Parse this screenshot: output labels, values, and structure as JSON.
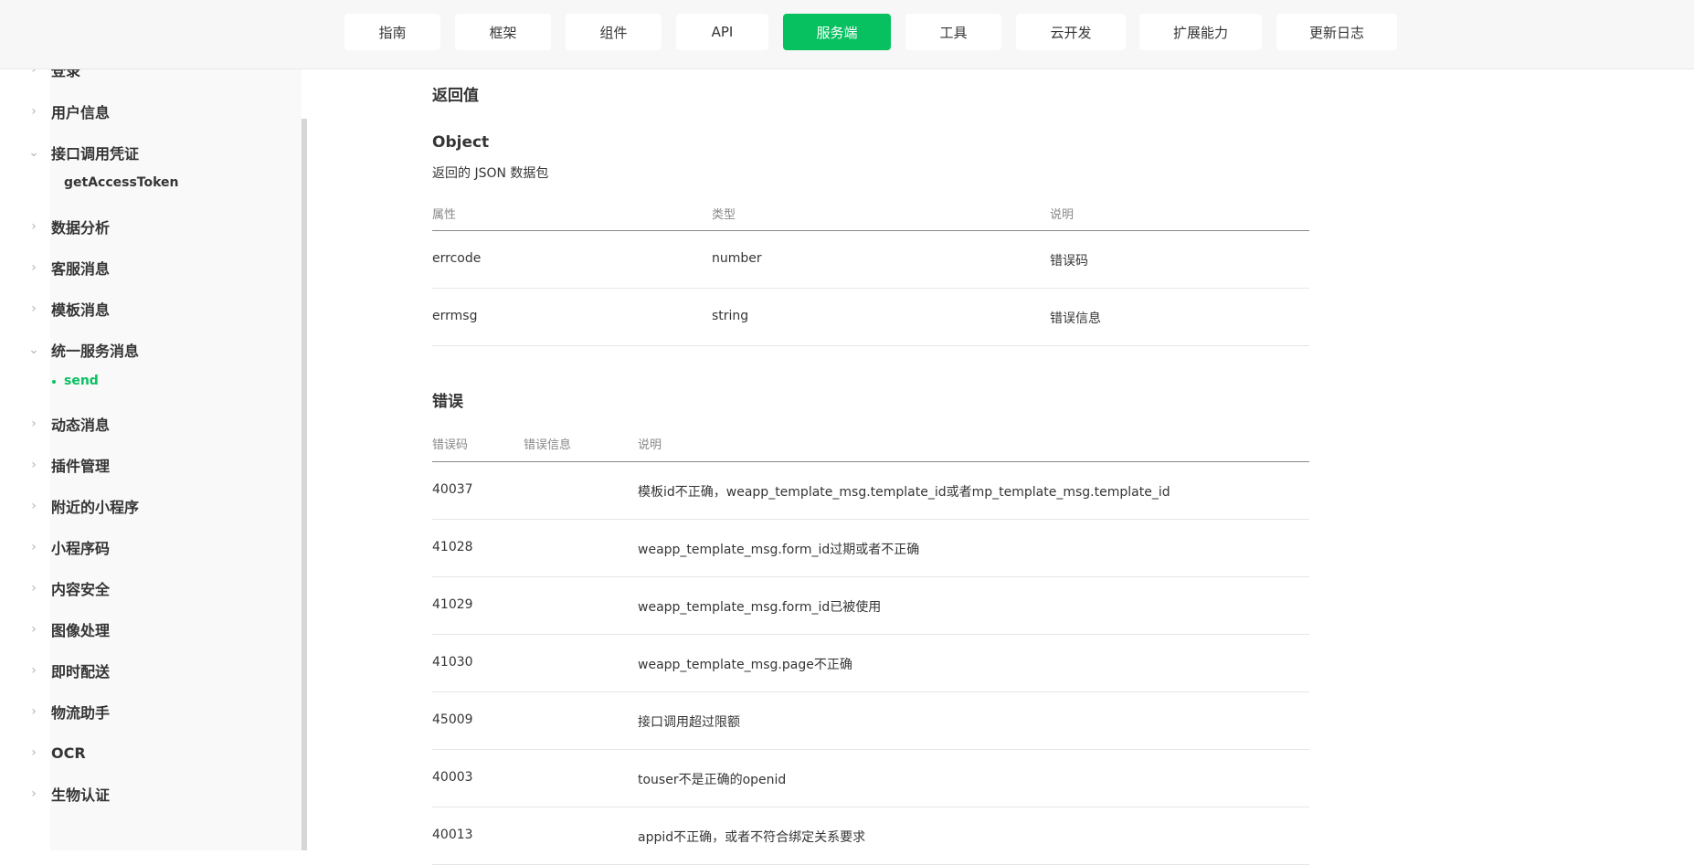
{
  "nav": {
    "tabs": [
      {
        "label": "指南"
      },
      {
        "label": "框架"
      },
      {
        "label": "组件"
      },
      {
        "label": "API"
      },
      {
        "label": "服务端"
      },
      {
        "label": "工具"
      },
      {
        "label": "云开发"
      },
      {
        "label": "扩展能力"
      },
      {
        "label": "更新日志"
      }
    ],
    "active_color": "#07c160"
  },
  "sidebar": {
    "items": [
      {
        "label": "登录"
      },
      {
        "label": "用户信息"
      },
      {
        "label": "接口调用凭证"
      },
      {
        "label": "数据分析"
      },
      {
        "label": "客服消息"
      },
      {
        "label": "模板消息"
      },
      {
        "label": "统一服务消息"
      },
      {
        "label": "动态消息"
      },
      {
        "label": "插件管理"
      },
      {
        "label": "附近的小程序"
      },
      {
        "label": "小程序码"
      },
      {
        "label": "内容安全"
      },
      {
        "label": "图像处理"
      },
      {
        "label": "即时配送"
      },
      {
        "label": "物流助手"
      },
      {
        "label": "OCR"
      },
      {
        "label": "生物认证"
      }
    ],
    "sub_token": "getAccessToken",
    "sub_send": "send"
  },
  "content": {
    "return_heading": "返回值",
    "object_heading": "Object",
    "object_desc": "返回的 JSON 数据包",
    "return_table": {
      "headers": [
        "属性",
        "类型",
        "说明"
      ],
      "rows": [
        [
          "errcode",
          "number",
          "错误码"
        ],
        [
          "errmsg",
          "string",
          "错误信息"
        ]
      ]
    },
    "error_heading": "错误",
    "error_table": {
      "headers": [
        "错误码",
        "错误信息",
        "说明"
      ],
      "rows": [
        [
          "40037",
          "",
          "模板id不正确，weapp_template_msg.template_id或者mp_template_msg.template_id"
        ],
        [
          "41028",
          "",
          "weapp_template_msg.form_id过期或者不正确"
        ],
        [
          "41029",
          "",
          "weapp_template_msg.form_id已被使用"
        ],
        [
          "41030",
          "",
          "weapp_template_msg.page不正确"
        ],
        [
          "45009",
          "",
          "接口调用超过限额"
        ],
        [
          "40003",
          "",
          "touser不是正确的openid"
        ],
        [
          "40013",
          "",
          "appid不正确，或者不符合绑定关系要求"
        ]
      ]
    }
  }
}
